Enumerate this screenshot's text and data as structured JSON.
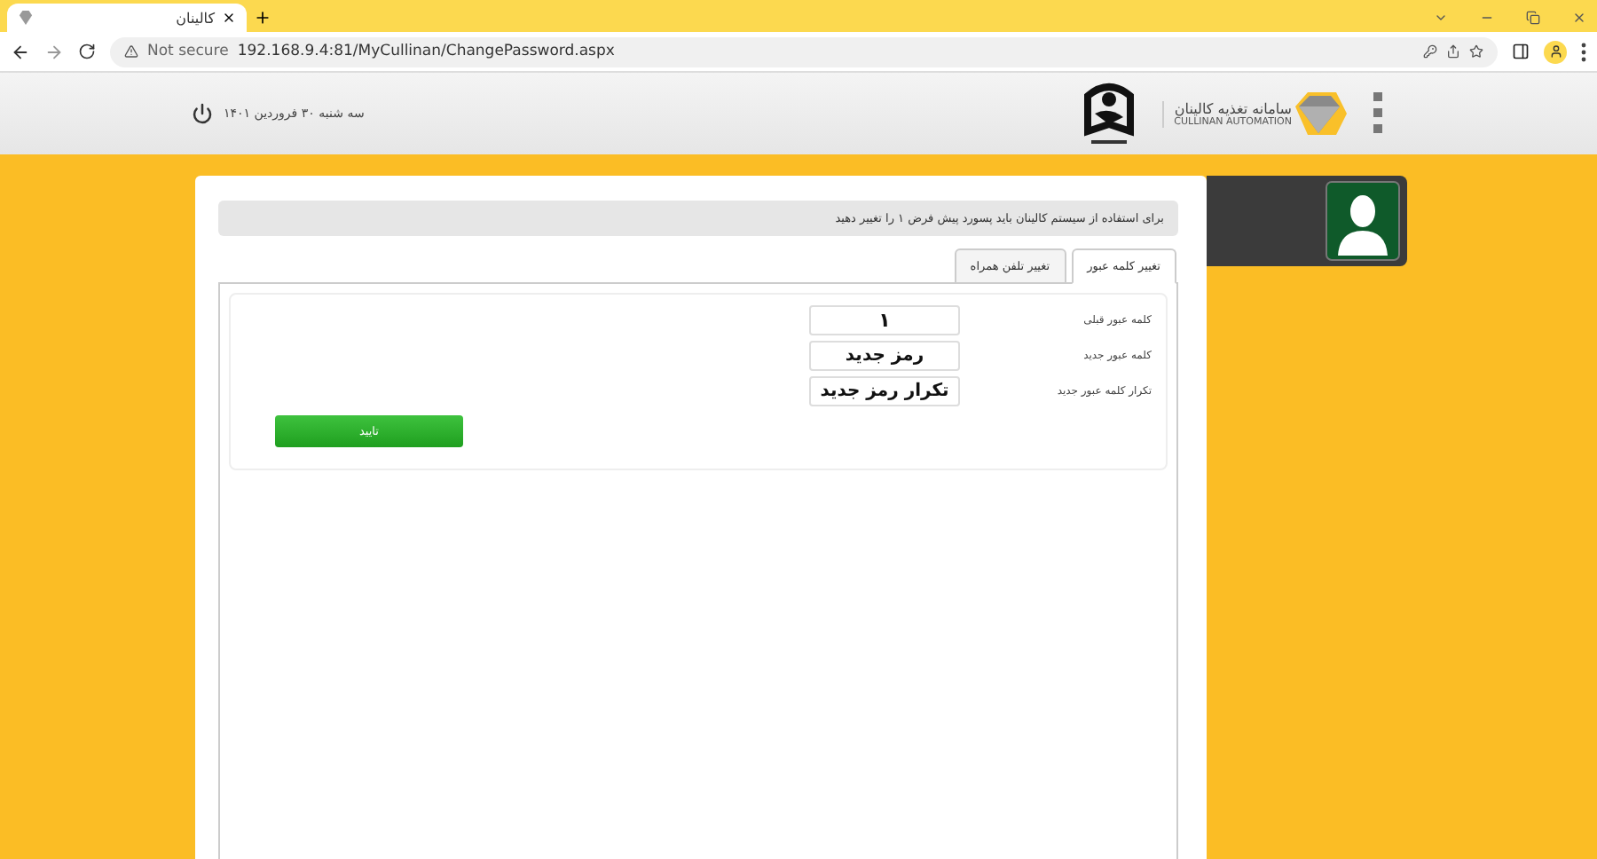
{
  "browser": {
    "tab_title": "کالینان",
    "security": "Not secure",
    "url": "192.168.9.4:81/MyCullinan/ChangePassword.aspx"
  },
  "header": {
    "date": "سه شنبه ۳۰ فروردین ۱۴۰۱",
    "brand_title": "سامانه تغذیه کالینان",
    "brand_subtitle": "CULLINAN AUTOMATION"
  },
  "notice": "برای استفاده از سیستم کالینان باید پسورد پیش فرض ۱ را تغییر دهید",
  "tabs": [
    {
      "label": "تغییر کلمه عبور",
      "selected": true
    },
    {
      "label": "تغییر تلفن همراه",
      "selected": false
    }
  ],
  "fields": [
    {
      "label": "کلمه عبور قبلی",
      "value": "۱"
    },
    {
      "label": "کلمه عبور جدید",
      "value": "رمز جدید"
    },
    {
      "label": "تکرار کلمه عبور جدید",
      "value": "تکرار رمز جدید"
    }
  ],
  "submit_button": "تایید"
}
